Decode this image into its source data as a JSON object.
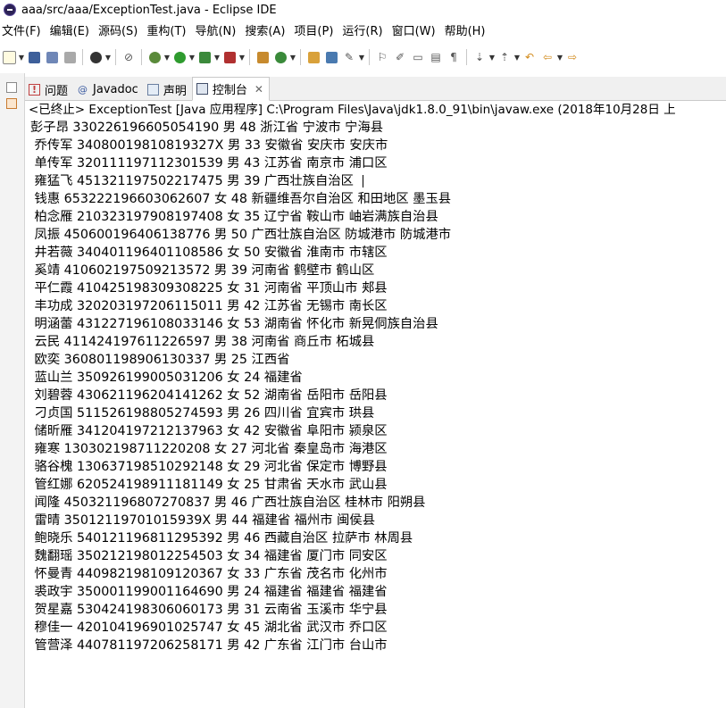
{
  "window": {
    "title": "aaa/src/aaa/ExceptionTest.java - Eclipse IDE"
  },
  "menu": [
    "文件(F)",
    "编辑(E)",
    "源码(S)",
    "重构(T)",
    "导航(N)",
    "搜索(A)",
    "项目(P)",
    "运行(R)",
    "窗口(W)",
    "帮助(H)"
  ],
  "tabs": [
    {
      "label": "问题",
      "icon": "problems-icon"
    },
    {
      "label": "Javadoc",
      "icon": "javadoc-icon"
    },
    {
      "label": "声明",
      "icon": "declaration-icon"
    },
    {
      "label": "控制台",
      "icon": "console-icon",
      "active": true
    }
  ],
  "console": {
    "status": "<已终止> ExceptionTest [Java 应用程序] C:\\Program Files\\Java\\jdk1.8.0_91\\bin\\javaw.exe  (2018年10月28日 上",
    "lines": [
      "彭子昂 330226196605054190 男 48 浙江省 宁波市 宁海县",
      " 乔传军 34080019810819327X 男 33 安徽省 安庆市 安庆市",
      " 单传军 320111197112301539 男 43 江苏省 南京市 浦口区",
      " 雍猛飞 451321197502217475 男 39 广西壮族自治区 ",
      " 钱惠 653222196603062607 女 48 新疆维吾尔自治区 和田地区 墨玉县",
      " 柏念雁 210323197908197408 女 35 辽宁省 鞍山市 岫岩满族自治县",
      " 凤振 450600196406138776 男 50 广西壮族自治区 防城港市 防城港市",
      " 井若薇 340401196401108586 女 50 安徽省 淮南市 市辖区",
      " 奚靖 410602197509213572 男 39 河南省 鹤壁市 鹤山区",
      " 平仁霞 410425198309308225 女 31 河南省 平顶山市 郏县",
      " 丰功成 320203197206115011 男 42 江苏省 无锡市 南长区",
      " 明涵蕾 431227196108033146 女 53 湖南省 怀化市 新晃侗族自治县",
      " 云民 411424197611226597 男 38 河南省 商丘市 柘城县",
      " 欧奕 360801198906130337 男 25 江西省",
      " 蓝山兰 350926199005031206 女 24 福建省",
      " 刘碧蓉 430621196204141262 女 52 湖南省 岳阳市 岳阳县",
      " 刁贞国 511526198805274593 男 26 四川省 宜宾市 珙县",
      " 储昕雁 341204197212137963 女 42 安徽省 阜阳市 颍泉区",
      " 雍寒 130302198711220208 女 27 河北省 秦皇岛市 海港区",
      " 骆谷槐 130637198510292148 女 29 河北省 保定市 博野县",
      " 管红娜 620524198911181149 女 25 甘肃省 天水市 武山县",
      " 闻隆 450321196807270837 男 46 广西壮族自治区 桂林市 阳朔县",
      " 雷晴 35012119701015939X 男 44 福建省 福州市 闽侯县",
      " 鲍晓乐 540121196811295392 男 46 西藏自治区 拉萨市 林周县",
      " 魏翻瑶 350212198012254503 女 34 福建省 厦门市 同安区",
      " 怀曼青 440982198109120367 女 33 广东省 茂名市 化州市",
      " 裘政宇 350001199001164690 男 24 福建省 福建省 福建省",
      " 贺星嘉 530424198306060173 男 31 云南省 玉溪市 华宁县",
      " 穆佳一 420104196901025747 女 45 湖北省 武汉市 乔口区",
      " 管营泽 440781197206258171 男 42 广东省 江门市 台山市"
    ]
  }
}
